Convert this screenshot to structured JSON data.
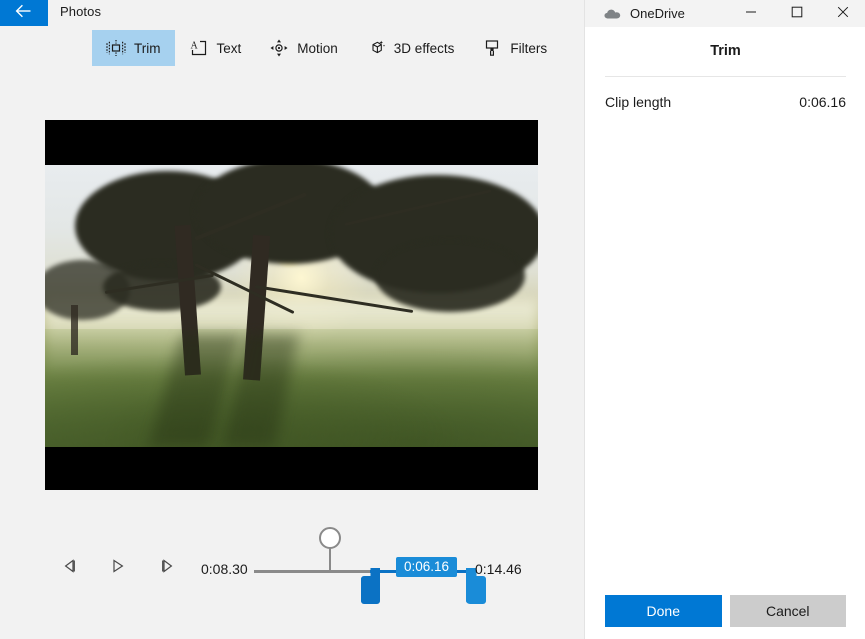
{
  "photos_app": {
    "title": "Photos",
    "back_icon": "back-arrow-icon",
    "toolbar": {
      "tabs": [
        {
          "label": "Trim",
          "icon": "trim-icon",
          "selected": true
        },
        {
          "label": "Text",
          "icon": "text-icon",
          "selected": false
        },
        {
          "label": "Motion",
          "icon": "motion-icon",
          "selected": false
        },
        {
          "label": "3D effects",
          "icon": "3d-effects-icon",
          "selected": false
        },
        {
          "label": "Filters",
          "icon": "filters-icon",
          "selected": false
        }
      ],
      "selected_tab_background": "#a6d1ef"
    },
    "preview": {
      "alt": "video frame of sunlit misty trees in a meadow",
      "letterbox_color": "#000000"
    },
    "timeline": {
      "prev_frame_icon": "previous-frame-icon",
      "play_icon": "play-icon",
      "next_frame_icon": "next-frame-icon",
      "start_time": "0:08.30",
      "end_time": "0:14.46",
      "clip_length_bubble": "0:06.16",
      "track_color": "#8a8a8a",
      "selection_color": "#0b72c4",
      "bubble_color": "#1a8cd8"
    }
  },
  "onedrive_window": {
    "title": "OneDrive",
    "icon": "onedrive-cloud-icon",
    "window_controls": {
      "minimize": "minimize-icon",
      "maximize": "maximize-icon",
      "close": "close-icon"
    },
    "panel": {
      "title": "Trim",
      "clip_length_label": "Clip length",
      "clip_length_value": "0:06.16",
      "done_label": "Done",
      "cancel_label": "Cancel",
      "done_color": "#0078d4",
      "cancel_color": "#cccccc"
    }
  }
}
